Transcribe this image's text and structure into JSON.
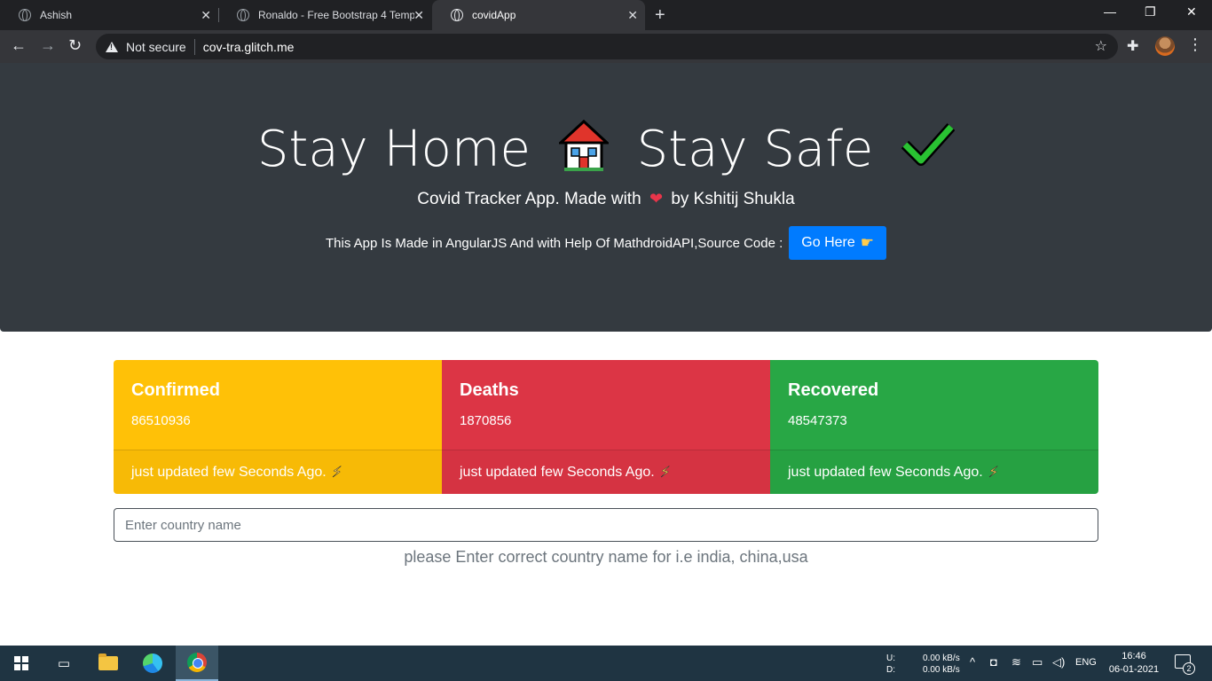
{
  "browser": {
    "tabs": [
      {
        "title": "Ashish",
        "close": "✕"
      },
      {
        "title": "Ronaldo - Free Bootstrap 4 Temp",
        "close": "✕"
      },
      {
        "title": "covidApp",
        "close": "✕"
      }
    ],
    "new_tab": "+",
    "window_controls": {
      "minimize": "—",
      "restore": "❐",
      "close": "✕"
    },
    "nav": {
      "back": "←",
      "forward": "→",
      "reload": "↻"
    },
    "security_label": "Not secure",
    "url": "cov-tra.glitch.me",
    "icons": [
      "warning-icon",
      "star-icon",
      "extensions-icon",
      "profile-avatar",
      "menu-icon"
    ]
  },
  "hero": {
    "title_part1": "Stay Home",
    "title_part2": "Stay Safe",
    "subtitle_prefix": "Covid Tracker App. Made with",
    "subtitle_suffix": "by Kshitij Shukla",
    "info_text": "This App Is Made in AngularJS And with Help Of MathdroidAPI,Source Code :",
    "button_label": "Go Here"
  },
  "stats": {
    "confirmed": {
      "label": "Confirmed",
      "value": "86510936",
      "footer": "just updated few Seconds Ago.",
      "color": "#ffc107"
    },
    "deaths": {
      "label": "Deaths",
      "value": "1870856",
      "footer": "just updated few Seconds Ago.",
      "color": "#dc3545"
    },
    "recovered": {
      "label": "Recovered",
      "value": "48547373",
      "footer": "just updated few Seconds Ago.",
      "color": "#28a745"
    }
  },
  "search": {
    "placeholder": "Enter country name",
    "value": "",
    "help": "please Enter correct country name for i.e india, china,usa"
  },
  "taskbar": {
    "upload_label": "U:",
    "download_label": "D:",
    "upload_speed": "0.00 kB/s",
    "download_speed": "0.00 kB/s",
    "language": "ENG",
    "time": "16:46",
    "date": "06-01-2021",
    "notification_count": "2"
  }
}
